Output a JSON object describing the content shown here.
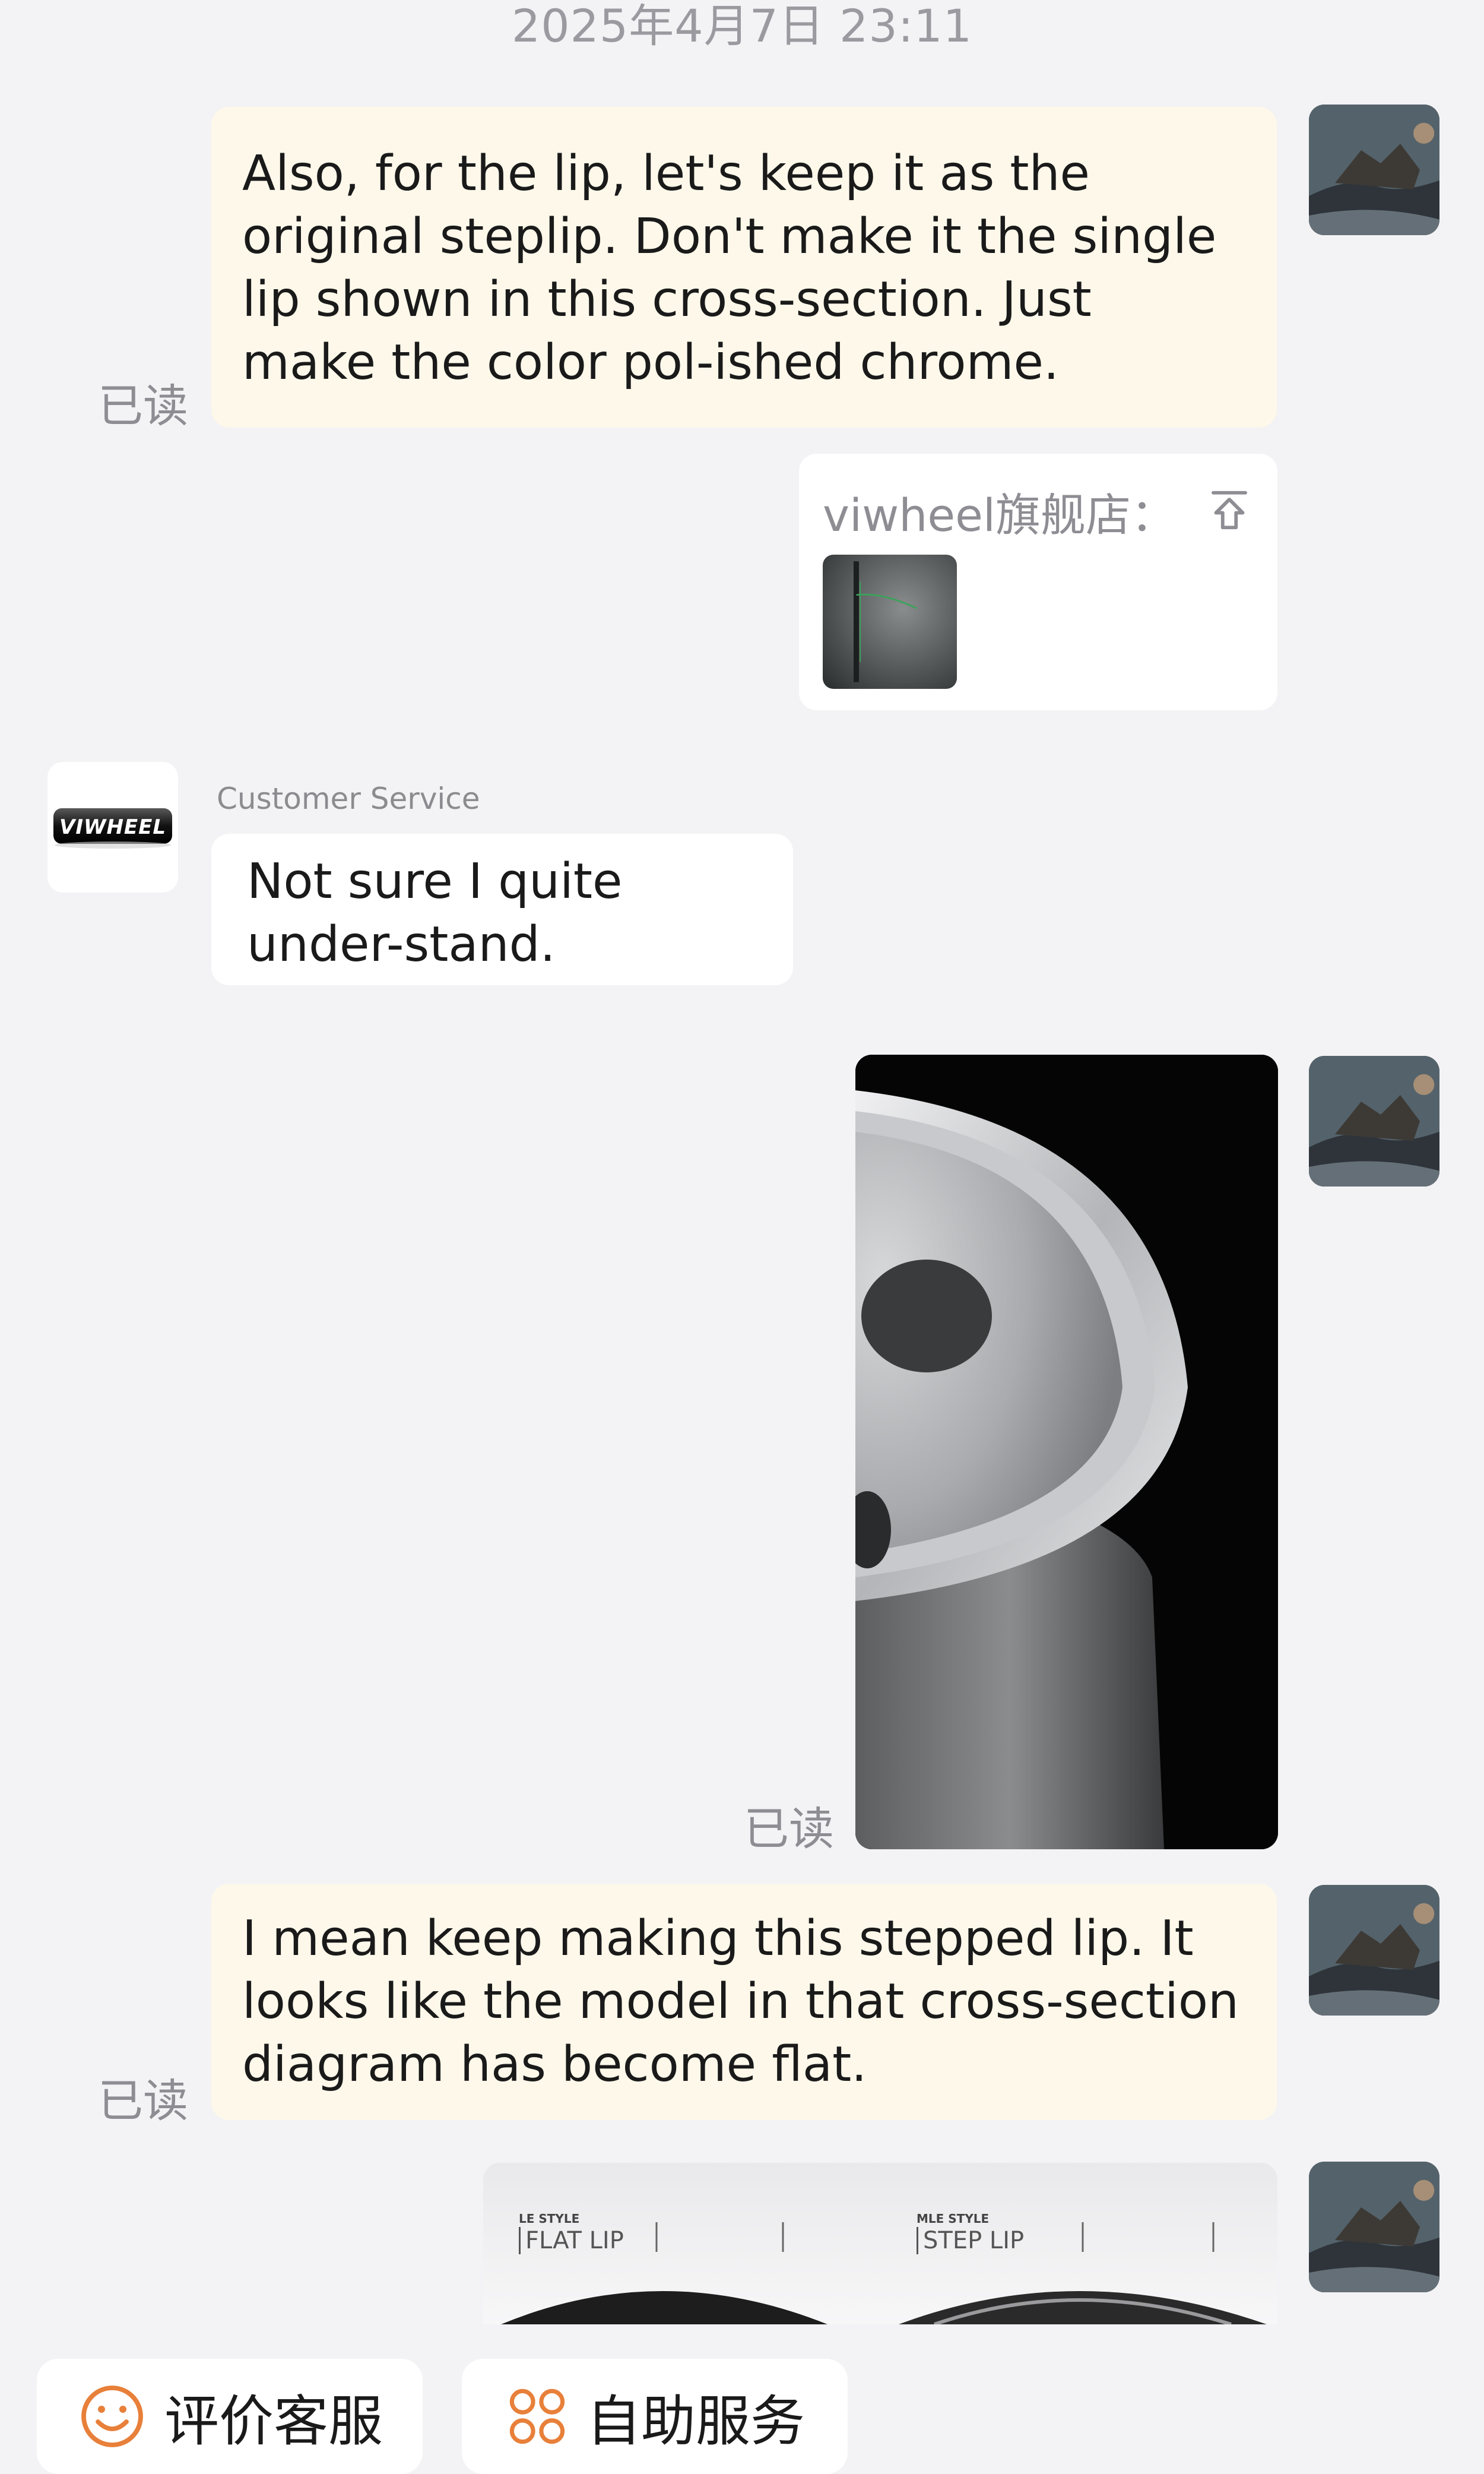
{
  "chat": {
    "timestamp": "2025年4月7日 23:11",
    "messages": [
      {
        "text": "Also, for the lip, let's keep it as the original steplip. Don't make it the single lip shown in this cross-section. Just make the color pol-ished chrome.",
        "read": "已读"
      },
      {
        "card_title": "viwheel旗舰店："
      },
      {
        "sender": "Customer Service",
        "logo_text": "VIWHEEL",
        "text": "Not sure I quite under-stand."
      },
      {
        "read": "已读"
      },
      {
        "text": "I mean keep making this stepped lip. It looks like the model in that cross-section diagram has become flat.",
        "read": "已读"
      },
      {
        "labels": {
          "left_style": "LE STYLE",
          "left_lip": "FLAT LIP",
          "right_style": "MLE STYLE",
          "right_lip": "STEP LIP"
        }
      }
    ]
  },
  "bottom_bar": {
    "rate_label": "评价客服",
    "self_service_label": "自助服务",
    "accent": "#e8803a"
  }
}
